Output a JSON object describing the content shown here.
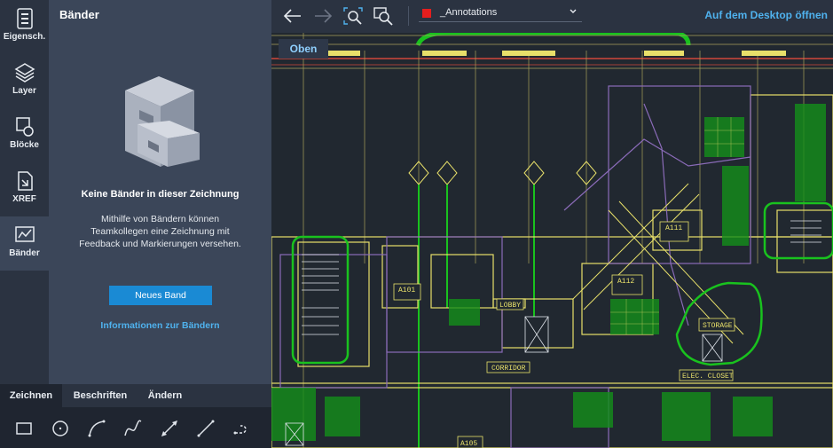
{
  "rail": {
    "items": [
      {
        "label": "Eigensch.",
        "icon": "properties-icon"
      },
      {
        "label": "Layer",
        "icon": "layers-icon"
      },
      {
        "label": "Blöcke",
        "icon": "blocks-icon"
      },
      {
        "label": "XREF",
        "icon": "xref-icon"
      },
      {
        "label": "Bänder",
        "icon": "traces-icon"
      }
    ]
  },
  "panel": {
    "title": "Bänder",
    "empty_title": "Keine Bänder in dieser Zeichnung",
    "empty_description": "Mithilfe von Bändern können Teamkollegen eine Zeichnung mit Feedback und Markierungen versehen.",
    "new_button": "Neues Band",
    "info_link": "Informationen zur Bändern"
  },
  "tools": {
    "tabs": [
      "Zeichnen",
      "Beschriften",
      "Ändern"
    ],
    "icons": [
      "rectangle-icon",
      "circle-icon",
      "arc-icon",
      "spline-icon",
      "measure-icon",
      "line-icon",
      "polyline-icon"
    ]
  },
  "toolbar": {
    "layer_name": "_Annotations",
    "layer_color": "#e51e1e",
    "desktop_link": "Auf dem Desktop öffnen"
  },
  "drawing": {
    "view_label": "Oben",
    "room_labels": [
      "A101",
      "A111",
      "A112",
      "A105",
      "LOBBY",
      "CORRIDOR",
      "STORAGE",
      "ELEC. CLOSET"
    ]
  },
  "colors": {
    "accent": "#1a8ad4",
    "link": "#4fb2ee",
    "cad_green": "#19c21e",
    "cad_yellow": "#e8e06a",
    "cad_purple": "#8a6bb8"
  }
}
